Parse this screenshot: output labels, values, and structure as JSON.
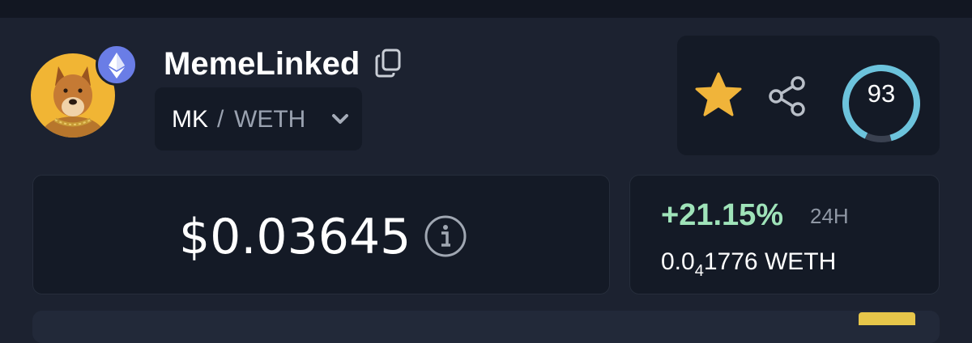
{
  "token": {
    "name": "MemeLinked",
    "chain_icon": "ethereum-icon",
    "avatar_icon": "shiba-dog-avatar"
  },
  "pair": {
    "base": "MK",
    "separator": "/",
    "quote": "WETH"
  },
  "actions": {
    "favorite_icon": "star-icon",
    "share_icon": "share-icon",
    "score": "93",
    "score_fraction": 0.93
  },
  "price": {
    "usd": "$0.03645",
    "info_icon": "info-icon"
  },
  "change": {
    "percent": "+21.15%",
    "period": "24H",
    "weth_prefix": "0.0",
    "weth_subscript": "4",
    "weth_digits": "1776",
    "weth_unit": "WETH"
  },
  "colors": {
    "background": "#1c2230",
    "card": "#141a26",
    "positive": "#9fe3b9",
    "star": "#f0b43a",
    "score_ring": "#6cc3dc",
    "chain": "#6a7de6"
  }
}
